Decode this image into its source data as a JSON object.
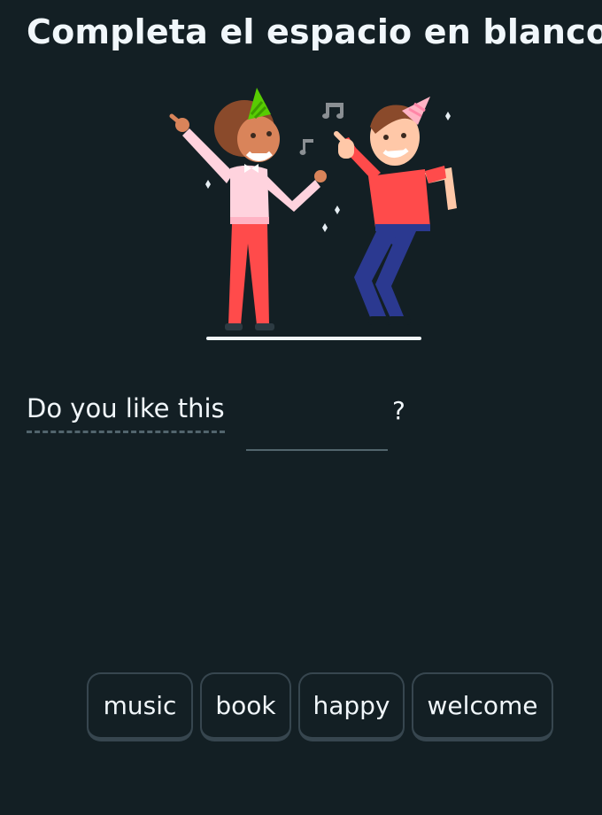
{
  "header": {
    "title": "Completa el espacio en blanco"
  },
  "illustration": {
    "icons": [
      "party-hat-icon",
      "music-note-icon",
      "confetti-icon"
    ],
    "colors": {
      "woman_shirt": "#ffd3de",
      "woman_pants": "#ff4b4b",
      "man_shirt": "#ff4b4b",
      "man_pants": "#2b3990",
      "hat_green": "#58cc02",
      "hat_pink": "#ffb3c4",
      "floor": "#f1f7fb"
    }
  },
  "exercise": {
    "prompt": "Do you like this",
    "blank_value": "",
    "punctuation": "?"
  },
  "word_bank": {
    "options": [
      {
        "label": "music"
      },
      {
        "label": "book"
      },
      {
        "label": "happy"
      },
      {
        "label": "welcome"
      }
    ]
  },
  "theme": {
    "background": "#131f24",
    "text": "#f1f7fb",
    "border": "#37464f"
  }
}
